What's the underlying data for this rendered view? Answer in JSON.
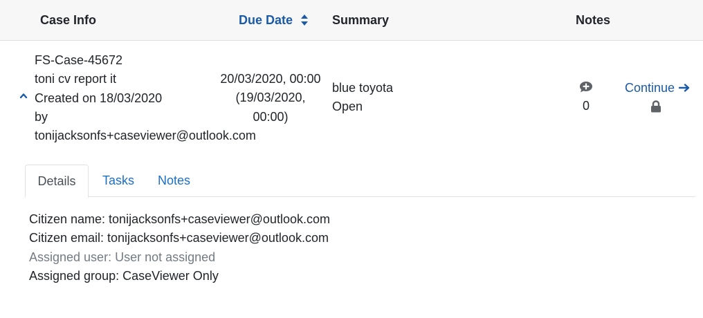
{
  "header": {
    "case_info": "Case Info",
    "due_date": "Due Date",
    "summary": "Summary",
    "notes": "Notes"
  },
  "case": {
    "id": "FS-Case-45672",
    "title": "toni cv report it",
    "created": "Created on 18/03/2020",
    "by": "by",
    "creator": "tonijacksonfs+caseviewer@outlook.com",
    "due_line1": "20/03/2020, 00:00",
    "due_line2": "(19/03/2020,",
    "due_line3": "00:00)",
    "summary_title": "blue toyota",
    "status": "Open",
    "notes_count": "0",
    "continue_label": "Continue"
  },
  "tabs": {
    "details": "Details",
    "tasks": "Tasks",
    "notes": "Notes"
  },
  "details": {
    "citizen_name": "Citizen name: tonijacksonfs+caseviewer@outlook.com",
    "citizen_email": "Citizen email: tonijacksonfs+caseviewer@outlook.com",
    "assigned_user": "Assigned user: User not assigned",
    "assigned_group": "Assigned group: CaseViewer Only"
  },
  "colors": {
    "accent": "#1a5aa6",
    "link": "#1a6fc7",
    "icon_gray": "#5f6368",
    "muted_text": "#747b83",
    "header_bg": "#f7f7f8"
  },
  "icons": {
    "sort": "sort-icon",
    "chevron": "chevron-up-icon",
    "note": "comment-plus-icon",
    "arrow": "arrow-right-icon",
    "lock": "lock-icon"
  }
}
